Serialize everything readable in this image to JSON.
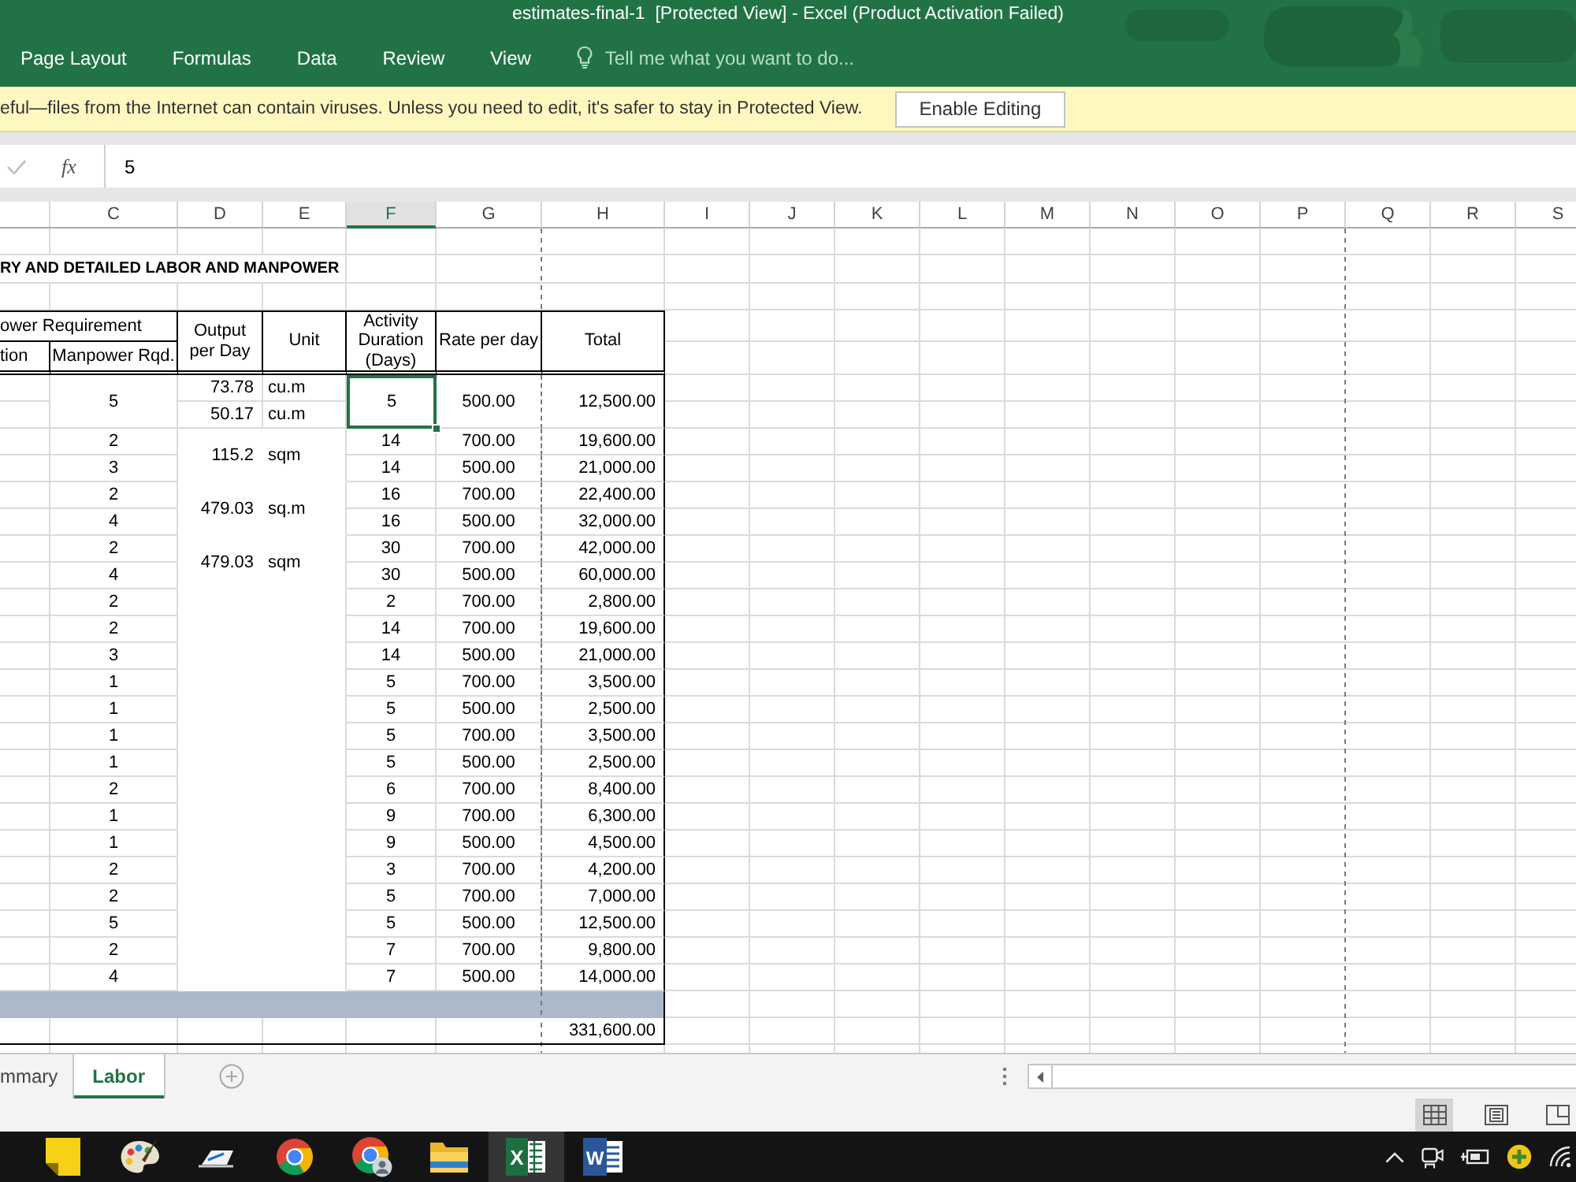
{
  "window": {
    "title": "estimates-final-1  [Protected View] - Excel (Product Activation Failed)"
  },
  "ribbon": {
    "tabs": [
      "Page Layout",
      "Formulas",
      "Data",
      "Review",
      "View"
    ],
    "tell_me": {
      "placeholder": "Tell me what you want to do..."
    }
  },
  "protected_view": {
    "message": "eful—files from the Internet can contain viruses. Unless you need to edit, it's safer to stay in Protected View.",
    "button": "Enable Editing"
  },
  "formula_bar": {
    "function_label": "fx",
    "value": "5"
  },
  "sheet": {
    "columns": [
      {
        "label": "C",
        "selected": false
      },
      {
        "label": "D",
        "selected": false
      },
      {
        "label": "E",
        "selected": false
      },
      {
        "label": "F",
        "selected": true
      },
      {
        "label": "G",
        "selected": false
      },
      {
        "label": "H",
        "selected": false
      },
      {
        "label": "I",
        "selected": false
      },
      {
        "label": "J",
        "selected": false
      },
      {
        "label": "K",
        "selected": false
      },
      {
        "label": "L",
        "selected": false
      },
      {
        "label": "M",
        "selected": false
      },
      {
        "label": "N",
        "selected": false
      },
      {
        "label": "O",
        "selected": false
      },
      {
        "label": "P",
        "selected": false
      },
      {
        "label": "Q",
        "selected": false
      },
      {
        "label": "R",
        "selected": false
      },
      {
        "label": "S",
        "selected": false
      }
    ],
    "title": "RY AND DETAILED LABOR AND MANPOWER",
    "header": {
      "group": "ower Requirement",
      "column_a": "tion",
      "manpower": "Manpower Rqd.",
      "output": "Output per Day",
      "unit": "Unit",
      "duration": "Activity Duration (Days)",
      "rate": "Rate per day",
      "total": "Total"
    },
    "groups": [
      {
        "outputs": [
          {
            "value": "73.78",
            "unit": "cu.m"
          },
          {
            "value": "50.17",
            "unit": "cu.m"
          }
        ],
        "rows": [
          {
            "manpower": "5",
            "duration": "5",
            "rate": "500.00",
            "total": "12,500.00",
            "selected": true
          }
        ]
      },
      {
        "outputs": [
          {
            "value": "115.2",
            "unit": "sqm"
          }
        ],
        "rows": [
          {
            "manpower": "2",
            "duration": "14",
            "rate": "700.00",
            "total": "19,600.00",
            "selected": false
          },
          {
            "manpower": "3",
            "duration": "14",
            "rate": "500.00",
            "total": "21,000.00",
            "selected": false
          }
        ]
      },
      {
        "outputs": [
          {
            "value": "479.03",
            "unit": "sq.m"
          }
        ],
        "rows": [
          {
            "manpower": "2",
            "duration": "16",
            "rate": "700.00",
            "total": "22,400.00",
            "selected": false
          },
          {
            "manpower": "4",
            "duration": "16",
            "rate": "500.00",
            "total": "32,000.00",
            "selected": false
          }
        ]
      },
      {
        "outputs": [
          {
            "value": "479.03",
            "unit": "sqm"
          }
        ],
        "rows": [
          {
            "manpower": "2",
            "duration": "30",
            "rate": "700.00",
            "total": "42,000.00",
            "selected": false
          },
          {
            "manpower": "4",
            "duration": "30",
            "rate": "500.00",
            "total": "60,000.00",
            "selected": false
          }
        ]
      },
      {
        "rows": [
          {
            "manpower": "2",
            "duration": "2",
            "rate": "700.00",
            "total": "2,800.00",
            "selected": false
          },
          {
            "manpower": "2",
            "duration": "14",
            "rate": "700.00",
            "total": "19,600.00",
            "selected": false
          },
          {
            "manpower": "3",
            "duration": "14",
            "rate": "500.00",
            "total": "21,000.00",
            "selected": false
          },
          {
            "manpower": "1",
            "duration": "5",
            "rate": "700.00",
            "total": "3,500.00",
            "selected": false
          },
          {
            "manpower": "1",
            "duration": "5",
            "rate": "500.00",
            "total": "2,500.00",
            "selected": false
          },
          {
            "manpower": "1",
            "duration": "5",
            "rate": "700.00",
            "total": "3,500.00",
            "selected": false
          },
          {
            "manpower": "1",
            "duration": "5",
            "rate": "500.00",
            "total": "2,500.00",
            "selected": false
          },
          {
            "manpower": "2",
            "duration": "6",
            "rate": "700.00",
            "total": "8,400.00",
            "selected": false
          },
          {
            "manpower": "1",
            "duration": "9",
            "rate": "700.00",
            "total": "6,300.00",
            "selected": false
          },
          {
            "manpower": "1",
            "duration": "9",
            "rate": "500.00",
            "total": "4,500.00",
            "selected": false
          },
          {
            "manpower": "2",
            "duration": "3",
            "rate": "700.00",
            "total": "4,200.00",
            "selected": false
          },
          {
            "manpower": "2",
            "duration": "5",
            "rate": "700.00",
            "total": "7,000.00",
            "selected": false
          },
          {
            "manpower": "5",
            "duration": "5",
            "rate": "500.00",
            "total": "12,500.00",
            "selected": false
          },
          {
            "manpower": "2",
            "duration": "7",
            "rate": "700.00",
            "total": "9,800.00",
            "selected": false
          },
          {
            "manpower": "4",
            "duration": "7",
            "rate": "500.00",
            "total": "14,000.00",
            "selected": false
          }
        ]
      }
    ],
    "grand_total": "331,600.00"
  },
  "sheet_tabs": [
    {
      "label": "mmary",
      "selected": false
    },
    {
      "label": "Labor",
      "selected": true
    }
  ],
  "status_bar": {
    "view_buttons": [
      {
        "kind": "normal",
        "selected": true
      },
      {
        "kind": "page_layout",
        "selected": false
      },
      {
        "kind": "page_break",
        "selected": false
      }
    ]
  },
  "taskbar": {
    "apps": [
      {
        "kind": "sticky_notes",
        "selected": false
      },
      {
        "kind": "paint",
        "selected": false
      },
      {
        "kind": "pen",
        "selected": false
      },
      {
        "kind": "browser",
        "selected": false
      },
      {
        "kind": "browser_profile",
        "selected": false
      },
      {
        "kind": "folder",
        "selected": false
      },
      {
        "kind": "spreadsheet",
        "letter": "X",
        "selected": true
      },
      {
        "kind": "document",
        "letter": "W",
        "selected": false
      }
    ]
  }
}
